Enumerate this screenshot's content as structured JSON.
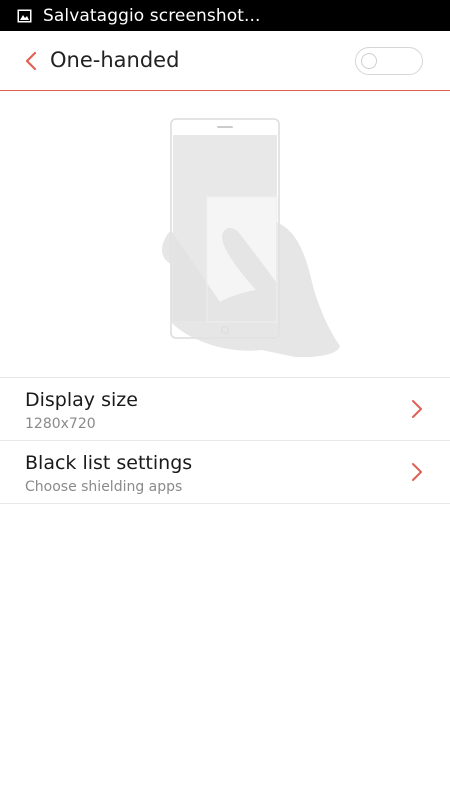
{
  "status_bar": {
    "icon": "image-icon",
    "text": "Salvataggio screenshot..."
  },
  "header": {
    "back_icon": "chevron-left-icon",
    "title": "One-handed",
    "toggle_state": "off"
  },
  "illustration": {
    "icon": "phone-with-hand-icon"
  },
  "settings": [
    {
      "title": "Display size",
      "subtitle": "1280x720",
      "icon": "chevron-right-icon"
    },
    {
      "title": "Black list settings",
      "subtitle": "Choose shielding apps",
      "icon": "chevron-right-icon"
    }
  ],
  "colors": {
    "accent": "#e06055",
    "status_bar": "#000000",
    "background": "#ffffff"
  }
}
